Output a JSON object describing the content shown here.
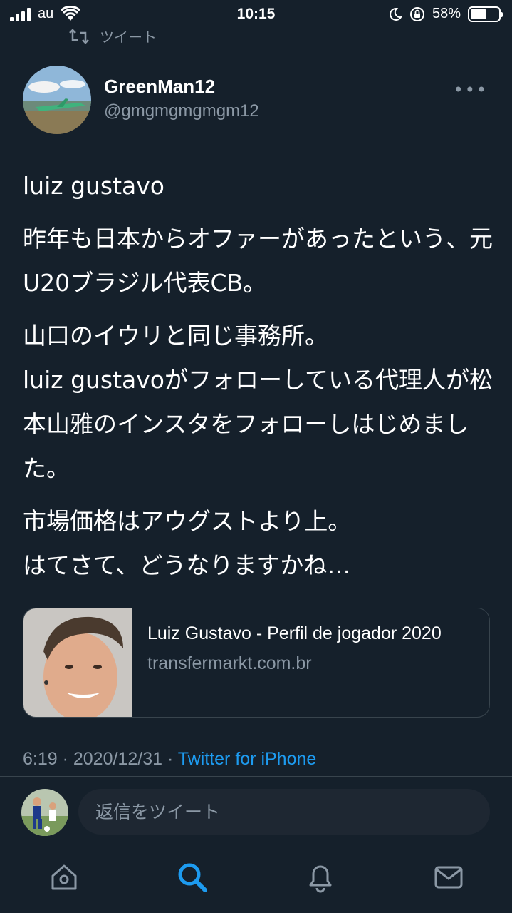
{
  "status": {
    "carrier": "au",
    "time": "10:15",
    "battery": "58%",
    "battery_level": 0.58
  },
  "retweet_context": {
    "label": "ツイート"
  },
  "tweet": {
    "author_name": "GreenMan12",
    "author_handle": "@gmgmgmgmgm12",
    "paragraphs": [
      "luiz gustavo",
      "昨年も日本からオファーがあったという、元U20ブラジル代表CB。",
      "山口のイウリと同じ事務所。\nluiz gustavoがフォローしている代理人が松本山雅のインスタをフォローしはじめました。",
      "市場価格はアウグストより上。\nはてさて、どうなりますかね…"
    ],
    "card": {
      "title": "Luiz Gustavo - Perfil de jogador 2020",
      "domain": "transfermarkt.com.br"
    },
    "timestamp": "6:19 · 2020/12/31 · ",
    "source": "Twitter for iPhone"
  },
  "reply": {
    "placeholder": "返信をツイート"
  },
  "tabbar": {
    "items": [
      "home-icon",
      "search-icon",
      "notifications-icon",
      "messages-icon"
    ],
    "active": "search-icon",
    "accent": "#1d9bf0"
  }
}
